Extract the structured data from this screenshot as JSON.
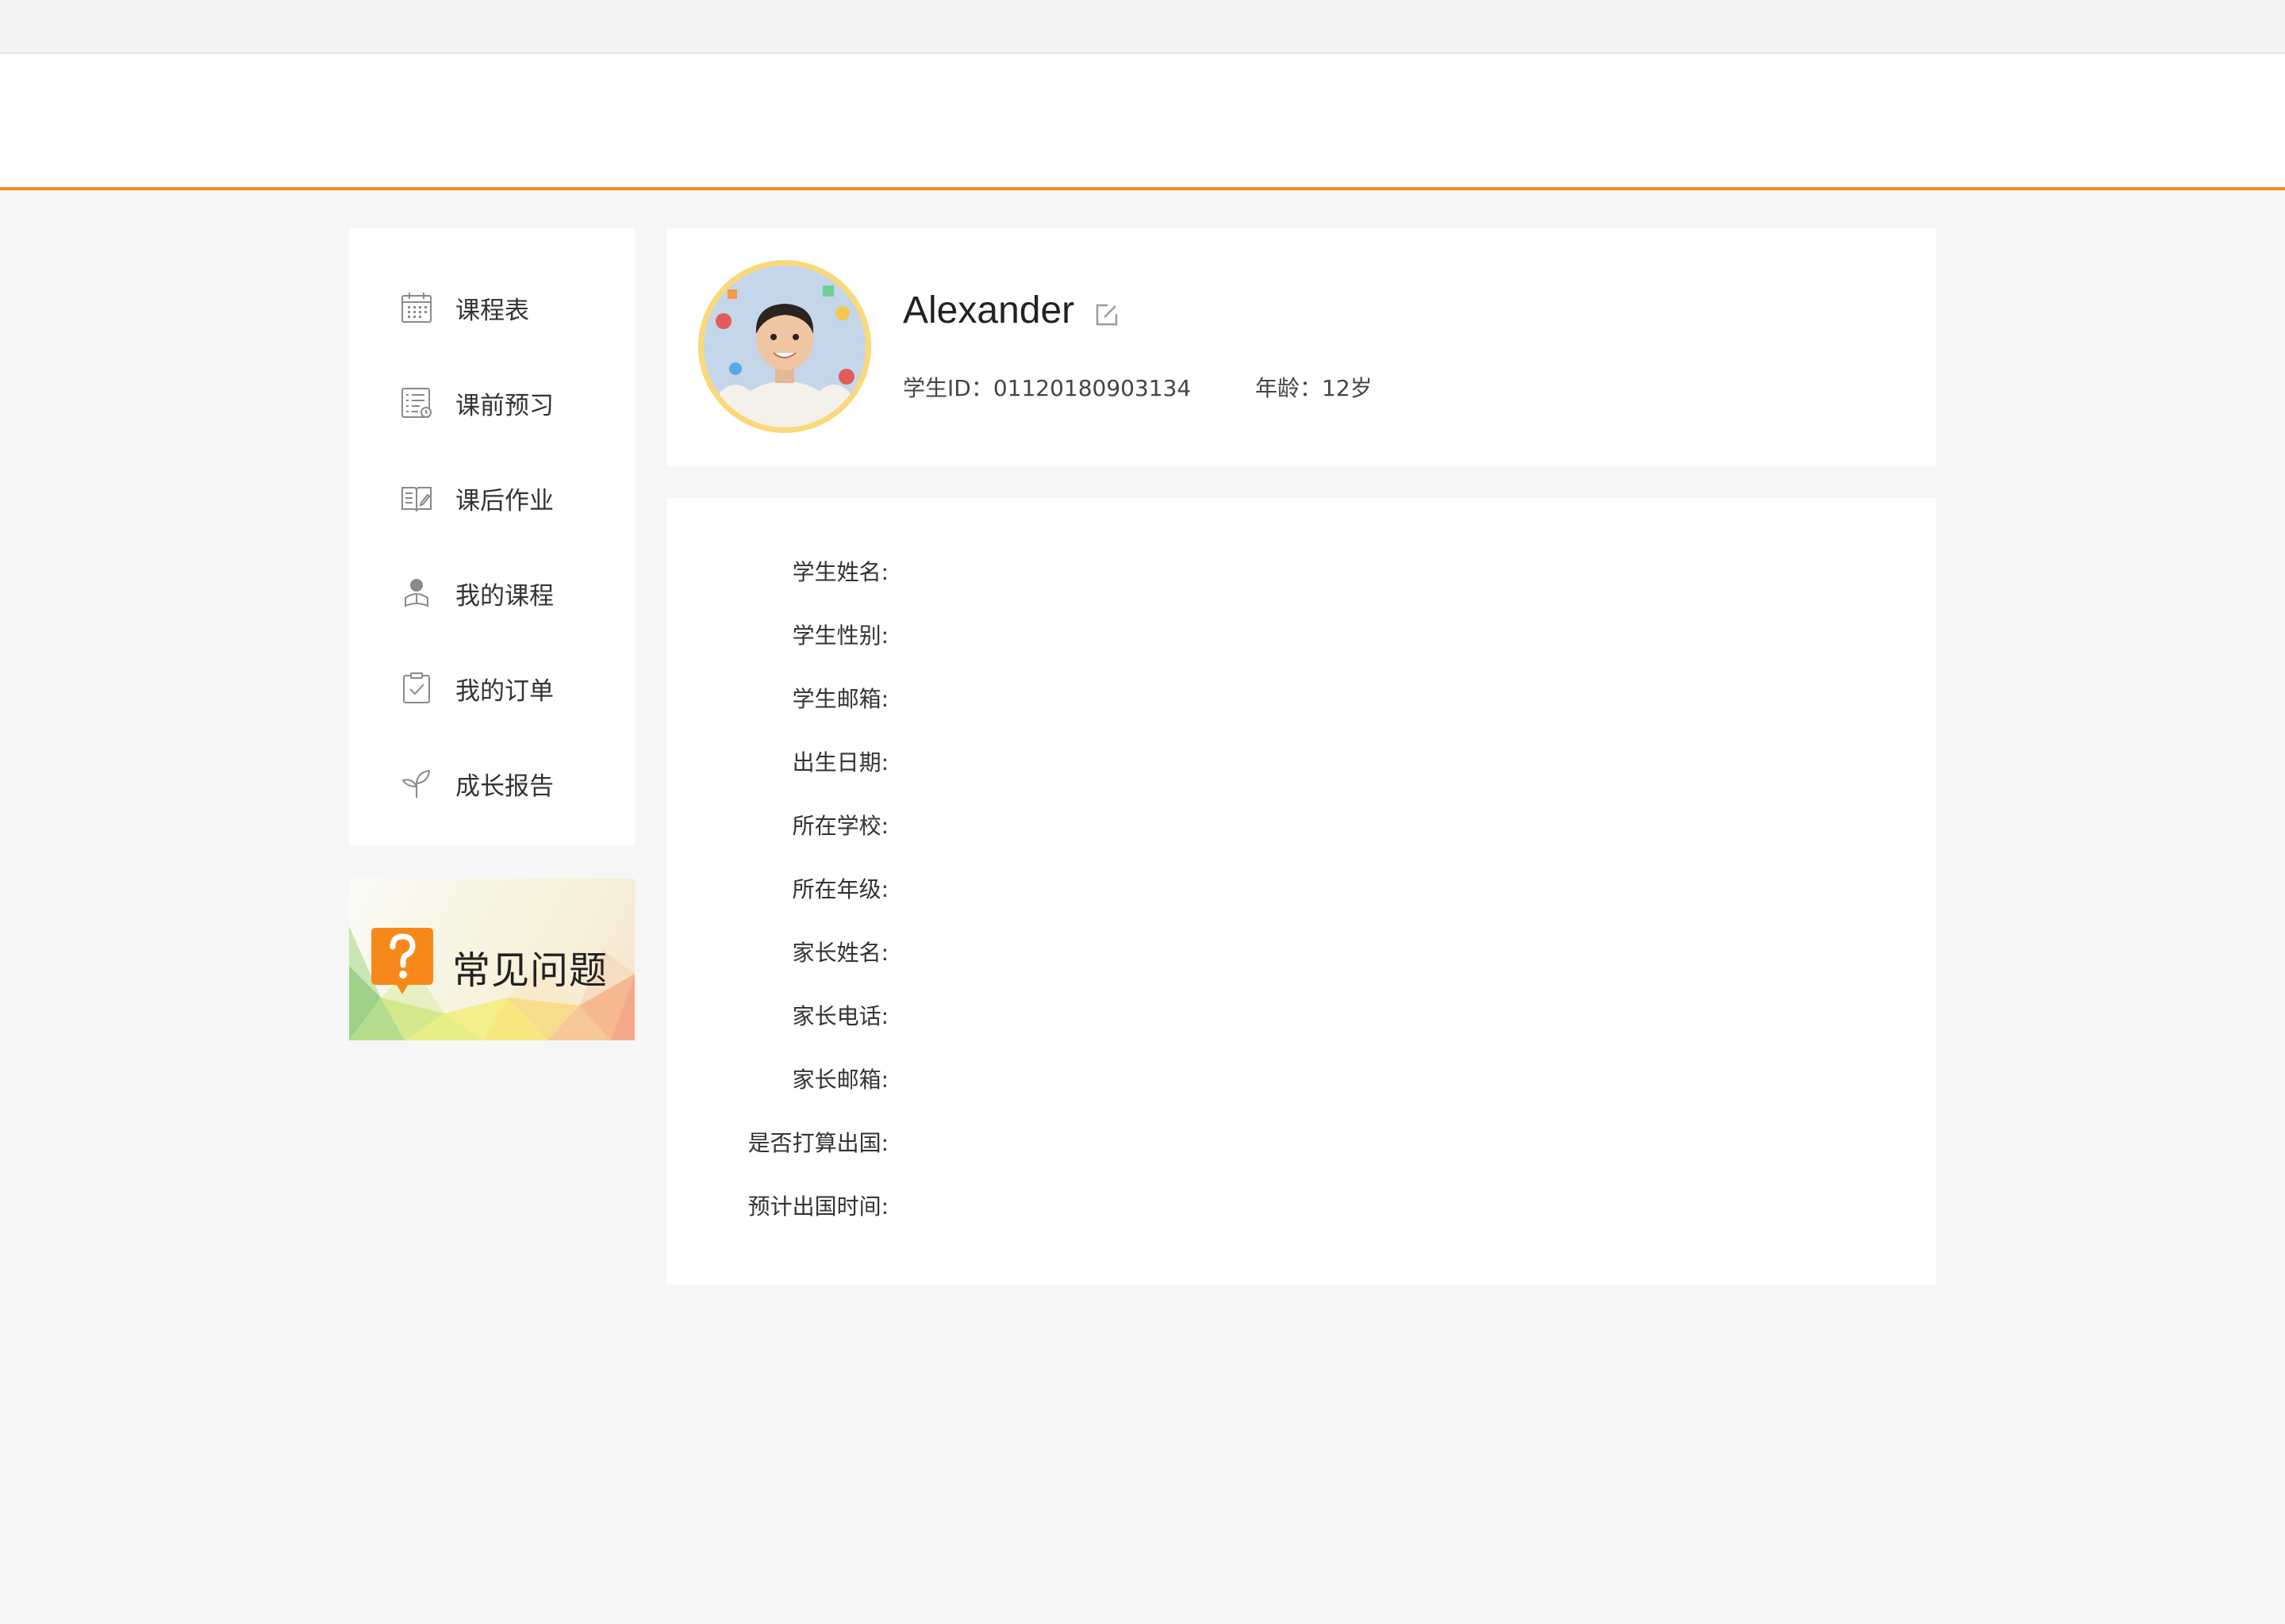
{
  "colors": {
    "accent": "#f7891b",
    "avatar_ring": "#fad97a",
    "faq_icon": "#f7891b"
  },
  "sidebar": {
    "items": [
      {
        "label": "课程表",
        "icon": "calendar-icon"
      },
      {
        "label": "课前预习",
        "icon": "checklist-icon"
      },
      {
        "label": "课后作业",
        "icon": "open-book-icon"
      },
      {
        "label": "我的课程",
        "icon": "student-icon"
      },
      {
        "label": "我的订单",
        "icon": "clipboard-check-icon"
      },
      {
        "label": "成长报告",
        "icon": "sprout-icon"
      }
    ]
  },
  "faq": {
    "label": "常见问题",
    "icon": "question-bubble-icon"
  },
  "profile": {
    "name": "Alexander",
    "id_text": "学生ID：01120180903134",
    "age_text": "年龄：12岁"
  },
  "details": {
    "fields": [
      {
        "label": "学生姓名:",
        "value": ""
      },
      {
        "label": "学生性别:",
        "value": ""
      },
      {
        "label": "学生邮箱:",
        "value": ""
      },
      {
        "label": "出生日期:",
        "value": ""
      },
      {
        "label": "所在学校:",
        "value": ""
      },
      {
        "label": "所在年级:",
        "value": ""
      },
      {
        "label": "家长姓名:",
        "value": ""
      },
      {
        "label": "家长电话:",
        "value": ""
      },
      {
        "label": "家长邮箱:",
        "value": ""
      },
      {
        "label": "是否打算出国:",
        "value": ""
      },
      {
        "label": "预计出国时间:",
        "value": ""
      }
    ]
  }
}
